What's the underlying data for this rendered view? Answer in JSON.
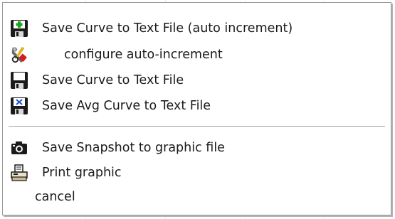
{
  "menu": {
    "items": [
      {
        "label": "Save Curve to Text File (auto increment)",
        "icon": "save-plus-icon"
      },
      {
        "label": "configure auto-increment",
        "icon": "tools-icon"
      },
      {
        "label": "Save Curve to Text File",
        "icon": "floppy-disk-icon"
      },
      {
        "label": "Save Avg Curve to Text File",
        "icon": "save-avg-icon"
      },
      {
        "label": "Save Snapshot to graphic file",
        "icon": "camera-icon"
      },
      {
        "label": "Print graphic",
        "icon": "printer-icon"
      },
      {
        "label": "cancel",
        "icon": ""
      }
    ]
  },
  "colors": {
    "menu_background": "#ffffff",
    "menu_border": "#9a9a9a",
    "text": "#1a1a1a",
    "separator": "#a0a0a0"
  }
}
